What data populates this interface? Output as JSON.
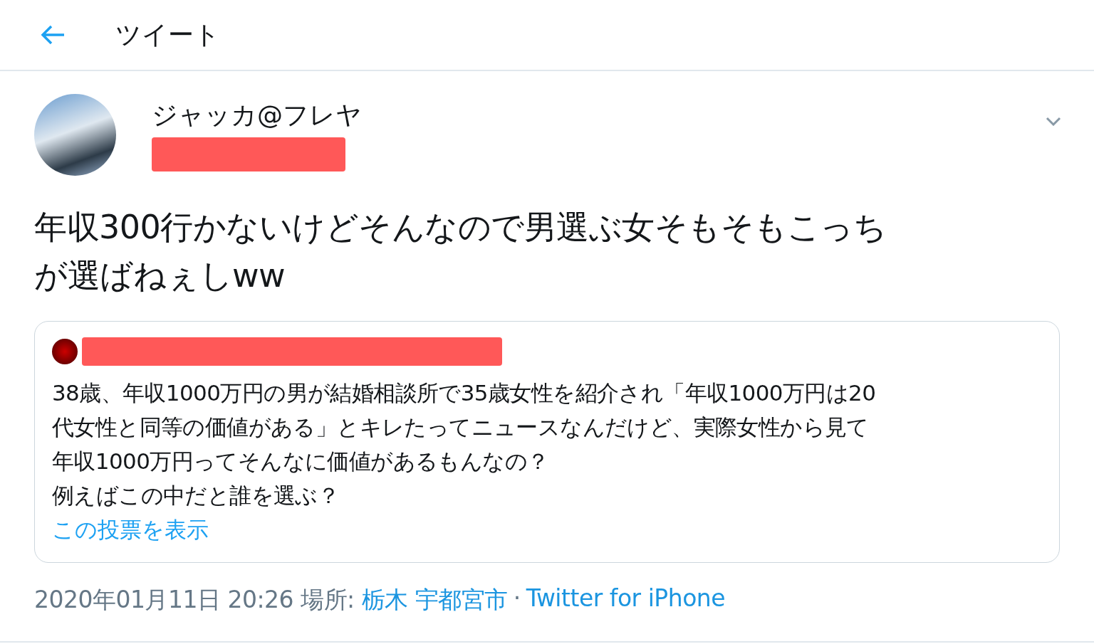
{
  "header": {
    "title": "ツイート"
  },
  "tweet": {
    "name": "ジャッカ@フレヤ",
    "text_lines": [
      "年収300行かないけどそんなので男選ぶ女そもそもこっち",
      "が選ばねぇしww"
    ]
  },
  "quote": {
    "lines": [
      "38歳、年収1000万円の男が結婚相談所で35歳女性を紹介され「年収1000万円は20",
      "代女性と同等の価値がある」とキレたってニュースなんだけど、実際女性から見て",
      "年収1000万円ってそんなに価値があるもんなの？",
      "例えばこの中だと誰を選ぶ？"
    ],
    "link": "この投票を表示"
  },
  "meta": {
    "datetime": "2020年01月11日 20:26",
    "place_label": "場所:",
    "place": "栃木 宇都宮市",
    "separator": "·",
    "source": "Twitter for iPhone"
  }
}
